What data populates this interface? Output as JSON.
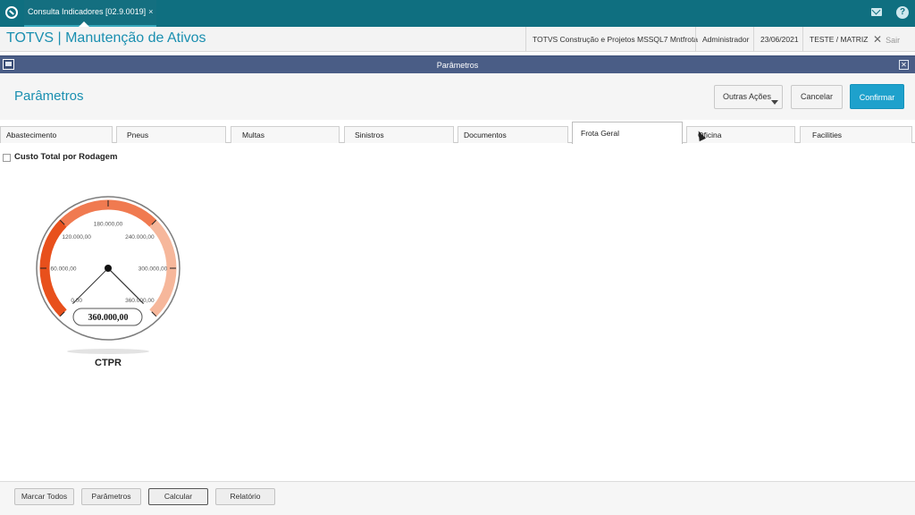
{
  "topbar": {
    "tab_label": "Consulta Indicadores [02.9.0019]",
    "tab_close": "×"
  },
  "header": {
    "app_title": "TOTVS | Manutenção de Ativos",
    "company": "TOTVS Construção e Projetos MSSQL7 Mntfrota",
    "user": "Administrador",
    "date": "23/06/2021",
    "branch": "TESTE / MATRIZ",
    "exit_label": "Sair"
  },
  "dialog": {
    "title": "Parâmetros",
    "page_title": "Parâmetros",
    "buttons": {
      "outras": "Outras Ações",
      "cancelar": "Cancelar",
      "confirmar": "Confirmar"
    }
  },
  "tabs": [
    {
      "label": "Abastecimento"
    },
    {
      "label": "Pneus"
    },
    {
      "label": "Multas"
    },
    {
      "label": "Sinistros"
    },
    {
      "label": "Documentos"
    },
    {
      "label": "Frota Geral",
      "active": true
    },
    {
      "label": "Oficina"
    },
    {
      "label": "Facilities"
    }
  ],
  "checkbox": {
    "label": "Custo Total por Rodagem",
    "checked": false
  },
  "gauge": {
    "label": "CTPR",
    "value_display": "360.000,00",
    "value": 360000,
    "min": 0,
    "max": 360000,
    "ticks": [
      "0,00",
      "60.000,00",
      "120.000,00",
      "180.000,00",
      "240.000,00",
      "300.000,00",
      "360.000,00"
    ],
    "colors": {
      "low": "#e8501c",
      "mid": "#f07a50",
      "high": "#f6b79b"
    }
  },
  "footer": {
    "buttons": [
      "Marcar Todos",
      "Parâmetros",
      "Calcular",
      "Relatório"
    ]
  }
}
